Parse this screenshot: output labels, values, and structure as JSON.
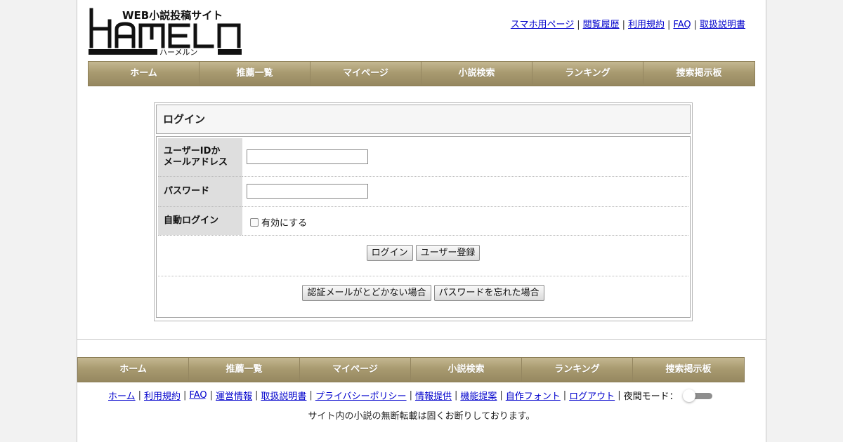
{
  "header": {
    "logo": {
      "tagline": "WEB小説投稿サイト",
      "wordmark": "HAMELN",
      "reading": "ハーメルン"
    },
    "links": [
      "スマホ用ページ",
      "閲覧履歴",
      "利用規約",
      "FAQ",
      "取扱説明書"
    ]
  },
  "nav": {
    "items": [
      "ホーム",
      "推薦一覧",
      "マイページ",
      "小説検索",
      "ランキング",
      "捜索掲示板"
    ]
  },
  "login": {
    "title": "ログイン",
    "user_label_line1": "ユーザーIDか",
    "user_label_line2": "メールアドレス",
    "user_value": "",
    "password_label": "パスワード",
    "password_value": "",
    "auto_login_label": "自動ログイン",
    "auto_login_checkbox": "有効にする",
    "auto_login_checked": false,
    "login_button": "ログイン",
    "register_button": "ユーザー登録",
    "mail_help_button": "認証メールがとどかない場合",
    "forgot_password_button": "パスワードを忘れた場合"
  },
  "footer": {
    "links": [
      "ホーム",
      "利用規約",
      "FAQ",
      "運営情報",
      "取扱説明書",
      "プライバシーポリシー",
      "情報提供",
      "機能提案",
      "自作フォント",
      "ログアウト"
    ],
    "night_mode_label": "夜間モード：",
    "night_mode_on": false,
    "notice": "サイト内の小説の無断転載は固くお断りしております。"
  },
  "colors": {
    "nav_gradient_top": "#c5b891",
    "nav_gradient_bottom": "#968860",
    "link": "#0000cc"
  }
}
